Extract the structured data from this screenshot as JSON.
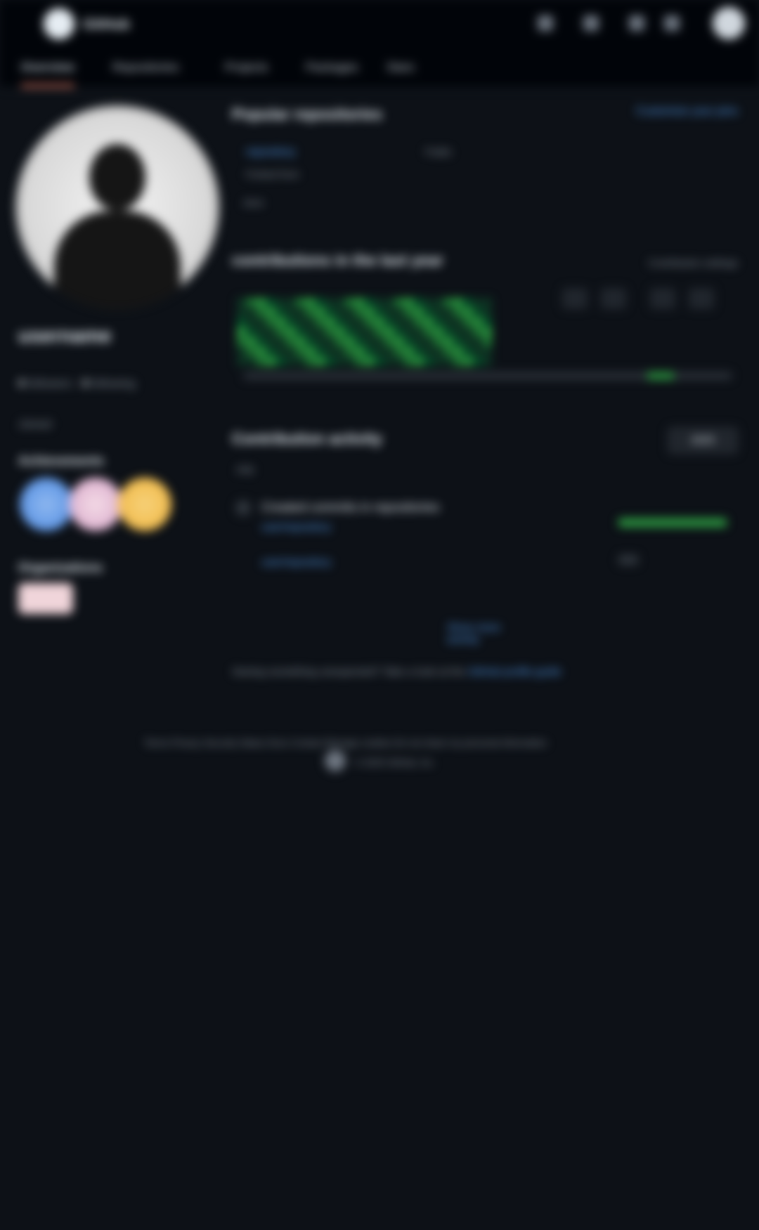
{
  "header": {
    "brand": "GitHub",
    "icons": [
      "search-icon",
      "plus-icon",
      "issues-icon",
      "pull-requests-icon",
      "notifications-icon"
    ]
  },
  "tabs": [
    "Overview",
    "Repositories",
    "Projects",
    "Packages",
    "Stars"
  ],
  "sidebar": {
    "username": "username",
    "followers_count": "0",
    "followers_label": "followers",
    "following_count": "0",
    "following_label": "following",
    "joined": "Joined",
    "achievements_title": "Achievements",
    "organizations_title": "Organizations",
    "badge_colors": [
      "#4a88e0",
      "#d5a3c8",
      "#f0b43c"
    ]
  },
  "main": {
    "popular_title": "Popular repositories",
    "customize": "Customize your pins",
    "repo_name": "repository",
    "repo_visibility": "Public",
    "repo_desc": "Forked from",
    "repo_lang": "Java",
    "contrib_title": "contributions in the last year",
    "contrib_settings": "Contribution settings",
    "year_labels": [
      "2025",
      "2024",
      "2023",
      "2022"
    ],
    "activity_title": "Contribution activity",
    "year_button": "2025",
    "month": "July",
    "activity_head": "Created commits in repositories",
    "activity_repos": [
      "user/repository",
      "user/repository"
    ],
    "show_more": "Show more activity",
    "note_text": "Seeing something unexpected? Take a look at the",
    "note_link": "GitHub profile guide"
  },
  "footer": {
    "links": "Terms  Privacy  Security  Status  Docs  Contact  Manage cookies  Do not share my personal information",
    "copyright": "© 2025 GitHub, Inc."
  }
}
